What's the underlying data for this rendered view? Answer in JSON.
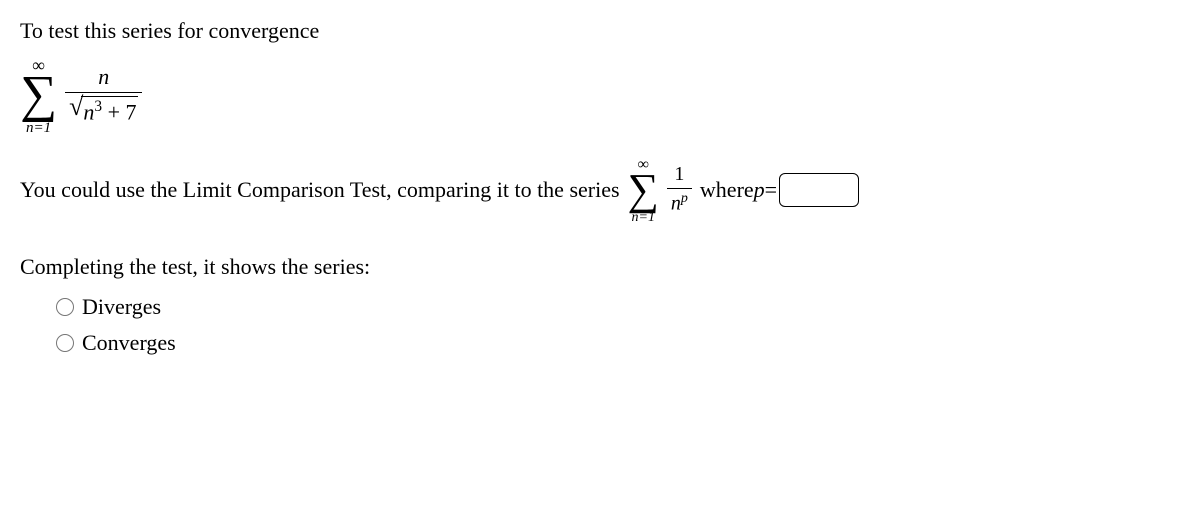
{
  "intro": "To test this series for convergence",
  "formula1": {
    "sigma_top": "∞",
    "sigma_bot": "n=1",
    "numerator": "n",
    "sqrt_inner_var": "n",
    "sqrt_inner_exp": "3",
    "sqrt_inner_plus": " + 7"
  },
  "line2_pre": "You could use the Limit Comparison Test, comparing it to the series ",
  "formula2": {
    "sigma_top": "∞",
    "sigma_bot": "n=1",
    "numerator": "1",
    "den_var": "n",
    "den_exp": "p"
  },
  "line2_post_where": " where ",
  "line2_var": "p",
  "line2_eq": "=",
  "input_value": "",
  "line3": "Completing the test, it shows the series:",
  "options": {
    "diverges": "Diverges",
    "converges": "Converges"
  }
}
